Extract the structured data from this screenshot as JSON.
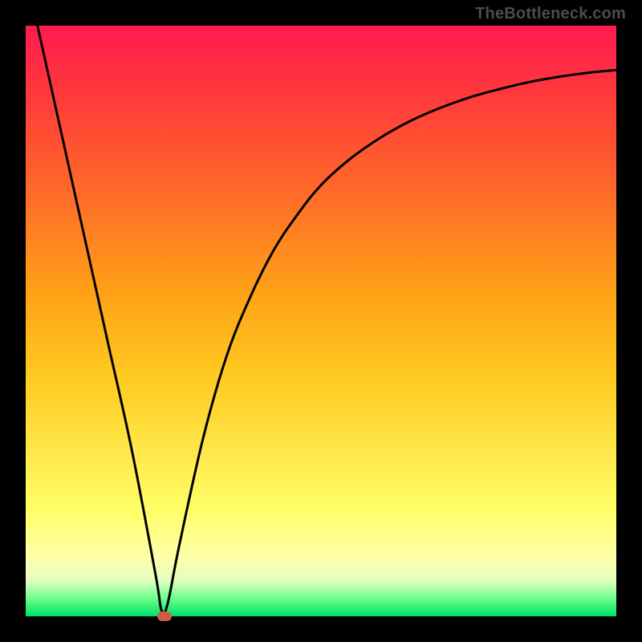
{
  "attribution": "TheBottleneck.com",
  "chart_data": {
    "type": "line",
    "title": "",
    "xlabel": "",
    "ylabel": "",
    "xlim": [
      0,
      100
    ],
    "ylim": [
      0,
      100
    ],
    "background_gradient": [
      "#ff1a4f",
      "#ffcc22",
      "#ffff66",
      "#00e066"
    ],
    "marker": {
      "x": 23.5,
      "y": 0,
      "color": "#d05a48"
    },
    "series": [
      {
        "name": "curve",
        "color": "#000000",
        "x": [
          2,
          6,
          10,
          14,
          18,
          22,
          23,
          24,
          26,
          30,
          34,
          38,
          42,
          46,
          50,
          55,
          60,
          65,
          70,
          75,
          80,
          85,
          90,
          95,
          100
        ],
        "y": [
          100,
          82,
          64,
          46,
          28,
          7,
          1,
          2,
          12,
          30,
          44,
          54,
          62,
          68,
          73,
          77.5,
          81,
          83.8,
          86,
          87.8,
          89.2,
          90.4,
          91.3,
          92,
          92.5
        ]
      }
    ]
  }
}
